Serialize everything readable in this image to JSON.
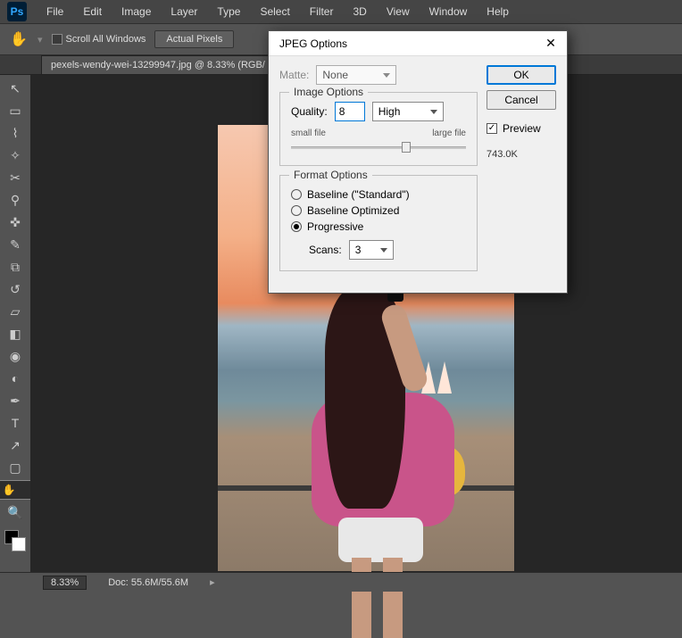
{
  "menubar": {
    "items": [
      "File",
      "Edit",
      "Image",
      "Layer",
      "Type",
      "Select",
      "Filter",
      "3D",
      "View",
      "Window",
      "Help"
    ]
  },
  "options_bar": {
    "checkbox_label": "Scroll All Windows",
    "btn_actual": "Actual Pixels"
  },
  "document": {
    "tab_label": "pexels-wendy-wei-13299947.jpg @ 8.33% (RGB/"
  },
  "status": {
    "zoom": "8.33%",
    "doc_label": "Doc: 55.6M/55.6M"
  },
  "tools": [
    "move",
    "marquee",
    "lasso",
    "wand",
    "crop",
    "eyedropper",
    "heal",
    "brush",
    "stamp",
    "history",
    "eraser",
    "gradient",
    "blur",
    "dodge",
    "pen",
    "type",
    "path",
    "shape",
    "hand",
    "zoom"
  ],
  "dialog": {
    "title": "JPEG Options",
    "matte": {
      "label": "Matte:",
      "value": "None"
    },
    "image_options": {
      "legend": "Image Options",
      "quality_label": "Quality:",
      "quality_value": "8",
      "quality_preset": "High",
      "small_label": "small file",
      "large_label": "large file",
      "slider_pct": 66
    },
    "format_options": {
      "legend": "Format Options",
      "baseline_std": "Baseline (\"Standard\")",
      "baseline_opt": "Baseline Optimized",
      "progressive": "Progressive",
      "selected": "progressive",
      "scans_label": "Scans:",
      "scans_value": "3"
    },
    "buttons": {
      "ok": "OK",
      "cancel": "Cancel"
    },
    "preview": {
      "label": "Preview",
      "checked": true
    },
    "filesize": "743.0K"
  }
}
